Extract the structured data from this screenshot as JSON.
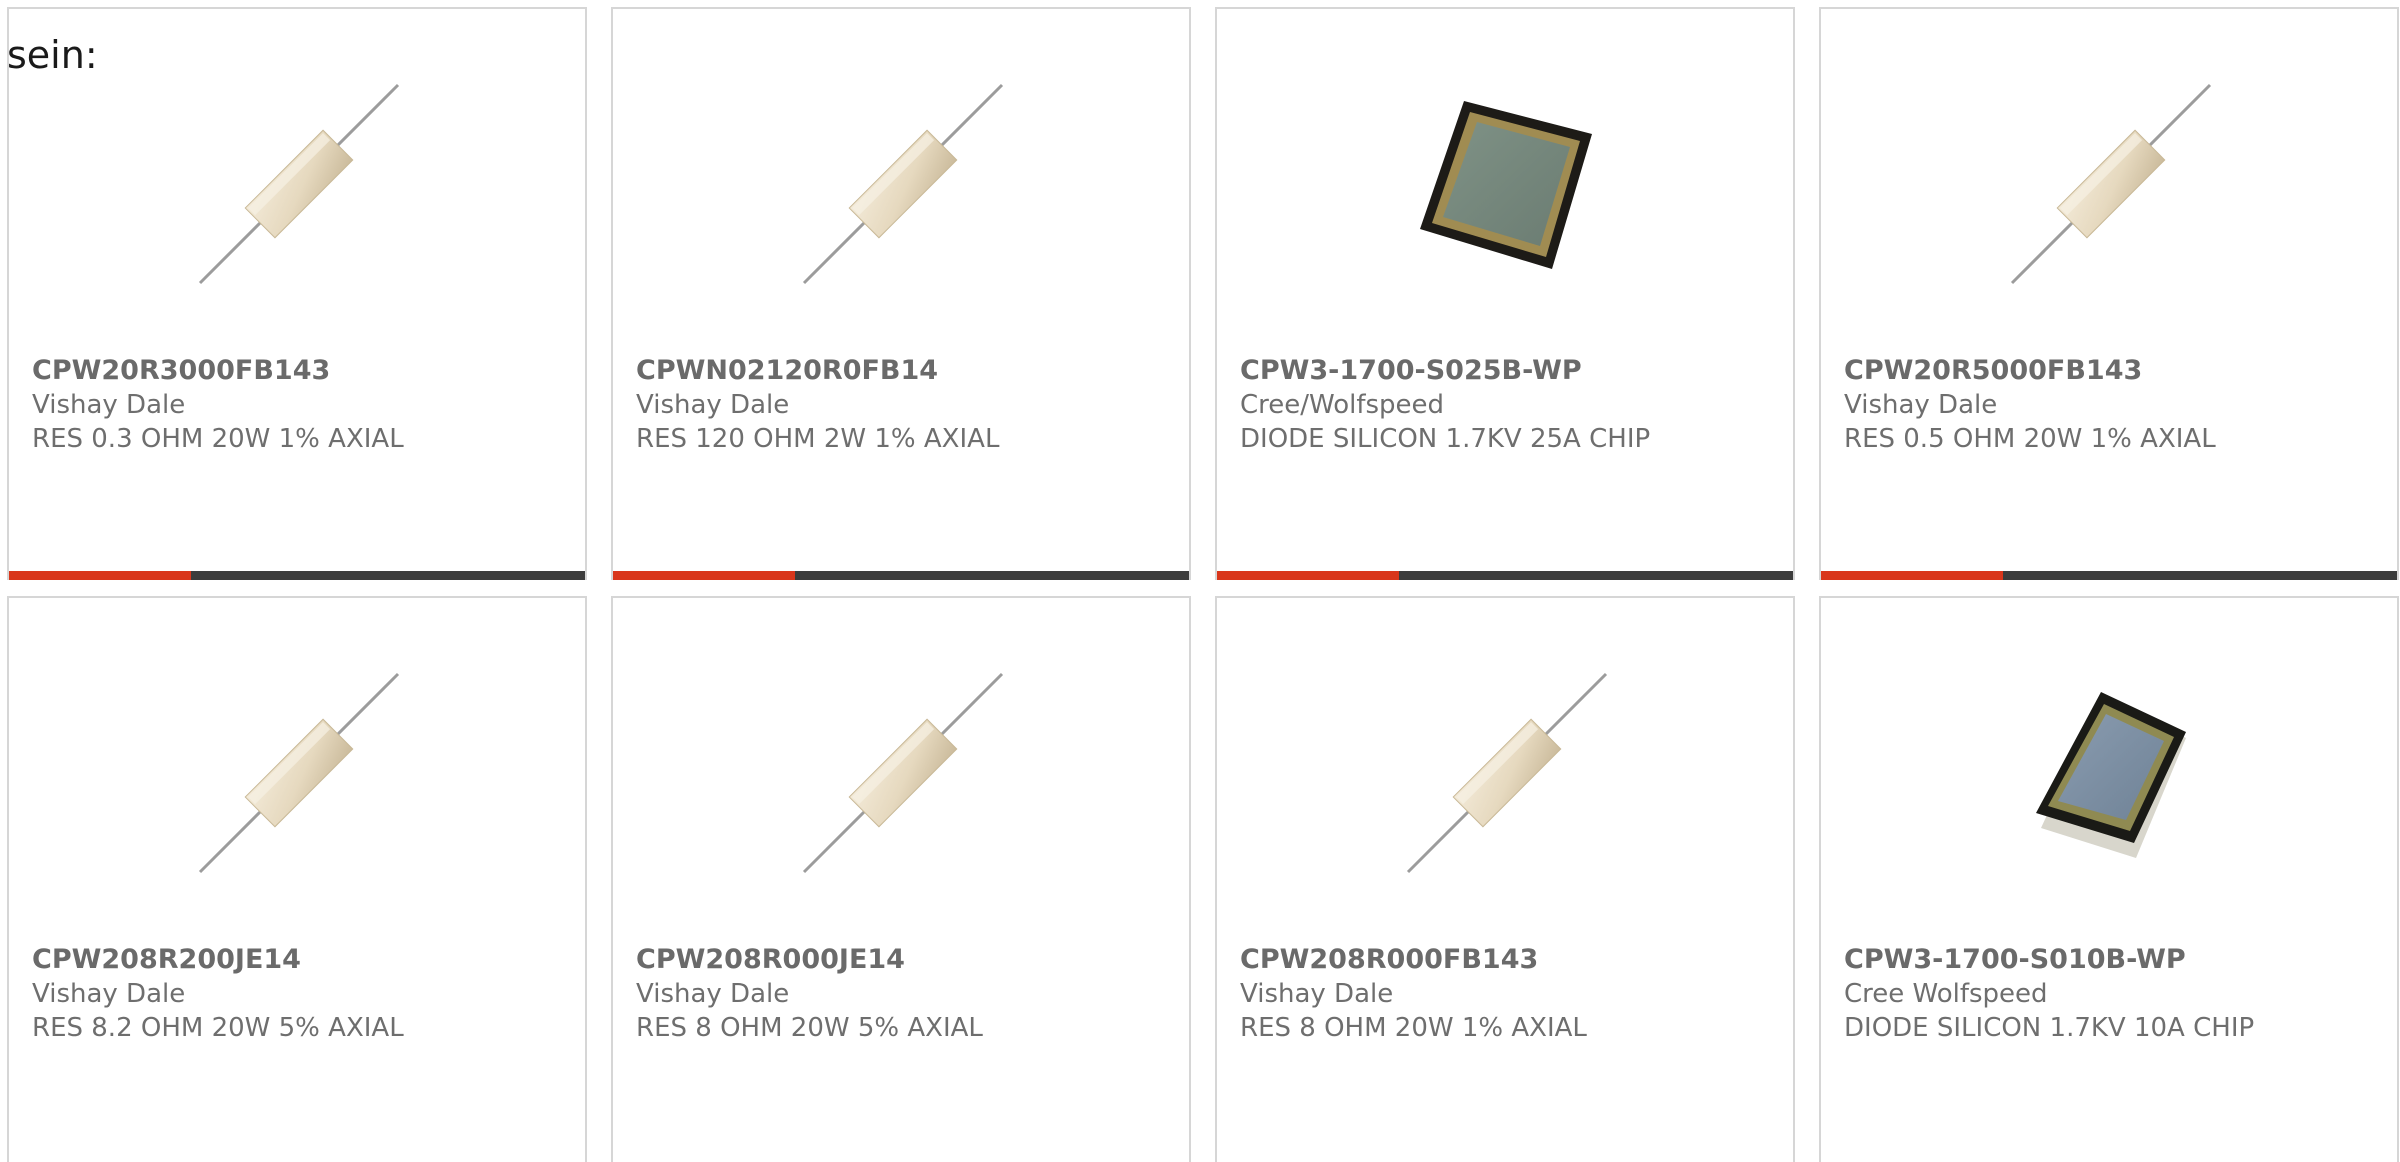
{
  "intro_text": "sein:",
  "colors": {
    "accent": "#d9361b",
    "bar": "#3c3c3c",
    "border": "#d6d6d6",
    "text": "#6e6e6e"
  },
  "products": [
    {
      "part_number": "CPW20R3000FB143",
      "manufacturer": "Vishay Dale",
      "description": "RES 0.3 OHM 20W 1% AXIAL",
      "image": "axial-resistor-image"
    },
    {
      "part_number": "CPWN02120R0FB14",
      "manufacturer": "Vishay Dale",
      "description": "RES 120 OHM 2W 1% AXIAL",
      "image": "axial-resistor-image"
    },
    {
      "part_number": "CPW3-1700-S025B-WP",
      "manufacturer": "Cree/Wolfspeed",
      "description": "DIODE SILICON 1.7KV 25A CHIP",
      "image": "diode-chip-image"
    },
    {
      "part_number": "CPW20R5000FB143",
      "manufacturer": "Vishay Dale",
      "description": "RES 0.5 OHM 20W 1% AXIAL",
      "image": "axial-resistor-image"
    },
    {
      "part_number": "CPW208R200JE14",
      "manufacturer": "Vishay Dale",
      "description": "RES 8.2 OHM 20W 5% AXIAL",
      "image": "axial-resistor-image"
    },
    {
      "part_number": "CPW208R000JE14",
      "manufacturer": "Vishay Dale",
      "description": "RES 8 OHM 20W 5% AXIAL",
      "image": "axial-resistor-image"
    },
    {
      "part_number": "CPW208R000FB143",
      "manufacturer": "Vishay Dale",
      "description": "RES 8 OHM 20W 1% AXIAL",
      "image": "axial-resistor-image"
    },
    {
      "part_number": "CPW3-1700-S010B-WP",
      "manufacturer": "Cree Wolfspeed",
      "description": "DIODE SILICON 1.7KV 10A CHIP",
      "image": "diode-chip-image"
    }
  ]
}
